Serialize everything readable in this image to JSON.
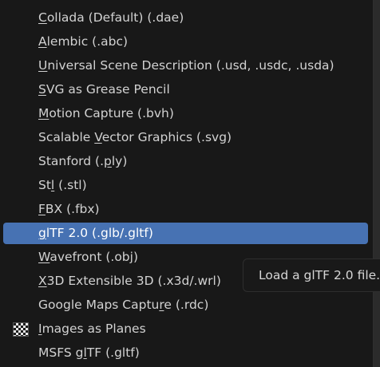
{
  "menu": {
    "items": [
      {
        "pre": "",
        "u": "C",
        "post": "ollada (Default) (.dae)"
      },
      {
        "pre": "",
        "u": "A",
        "post": "lembic (.abc)"
      },
      {
        "pre": "",
        "u": "U",
        "post": "niversal Scene Description (.usd, .usdc, .usda)"
      },
      {
        "pre": "",
        "u": "S",
        "post": "VG as Grease Pencil"
      },
      {
        "pre": "",
        "u": "M",
        "post": "otion Capture (.bvh)"
      },
      {
        "pre": "Scalable ",
        "u": "V",
        "post": "ector Graphics (.svg)"
      },
      {
        "pre": "Stanford (.",
        "u": "p",
        "post": "ly)"
      },
      {
        "pre": "St",
        "u": "l",
        "post": " (.stl)"
      },
      {
        "pre": "",
        "u": "F",
        "post": "BX (.fbx)"
      },
      {
        "pre": "",
        "u": "g",
        "post": "lTF 2.0 (.glb/.gltf)"
      },
      {
        "pre": "",
        "u": "W",
        "post": "avefront (.obj)"
      },
      {
        "pre": "",
        "u": "X",
        "post": "3D Extensible 3D (.x3d/.wrl)"
      },
      {
        "pre": "Google Maps Captu",
        "u": "r",
        "post": "e (.rdc)"
      },
      {
        "pre": "",
        "u": "I",
        "post": "mages as Planes"
      },
      {
        "pre": "MSFS g",
        "u": "l",
        "post": "TF (.gltf)"
      }
    ],
    "active_index": 9,
    "colors": {
      "highlight": "#4772b3",
      "background": "#181818",
      "text": "#d2d2d2"
    },
    "item_icons": {
      "13": "checkerboard-image-icon"
    }
  },
  "tooltip": {
    "text": "Load a glTF 2.0 file."
  }
}
